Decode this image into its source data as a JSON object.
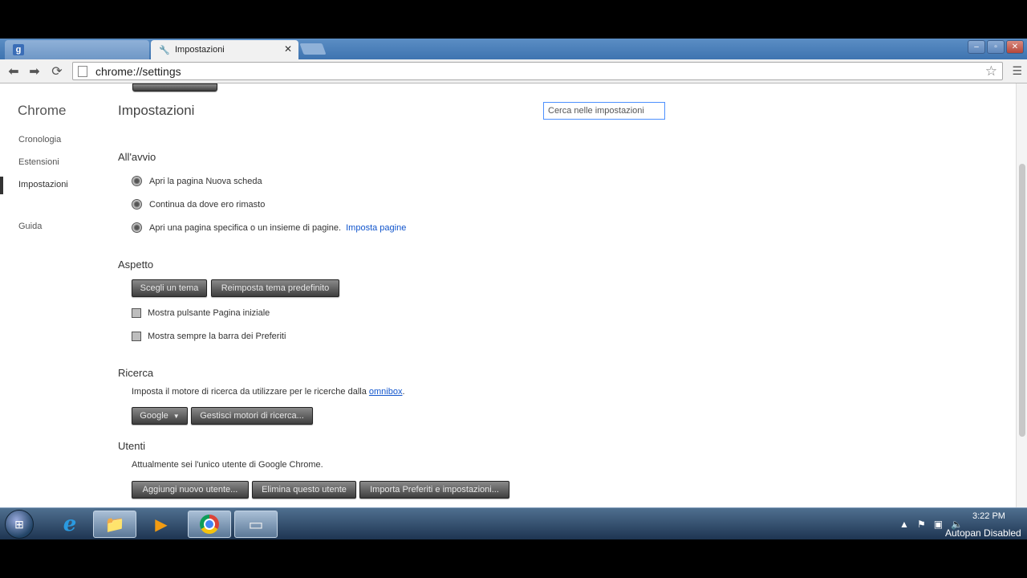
{
  "tabs": {
    "inactive_label": "",
    "active_label": "Impostazioni"
  },
  "window_controls": {
    "minimize": "–",
    "maximize": "▫",
    "close": "✕"
  },
  "omnibox": {
    "url": "chrome://settings"
  },
  "sidebar": {
    "title": "Chrome",
    "items": [
      {
        "label": "Cronologia"
      },
      {
        "label": "Estensioni"
      },
      {
        "label": "Impostazioni"
      },
      {
        "label": "Guida"
      }
    ]
  },
  "main": {
    "title": "Impostazioni",
    "search_placeholder": "Cerca nelle impostazioni",
    "startup": {
      "title": "All'avvio",
      "options": [
        "Apri la pagina Nuova scheda",
        "Continua da dove ero rimasto",
        "Apri una pagina specifica o un insieme di pagine."
      ],
      "set_pages_link": "Imposta pagine"
    },
    "appearance": {
      "title": "Aspetto",
      "choose_theme": "Scegli un tema",
      "reset_theme": "Reimposta tema predefinito",
      "show_home": "Mostra pulsante Pagina iniziale",
      "show_bookmarks": "Mostra sempre la barra dei Preferiti"
    },
    "search": {
      "title": "Ricerca",
      "description": "Imposta il motore di ricerca da utilizzare per le ricerche dalla",
      "omnibox_link": "omnibox",
      "description_end": ".",
      "engine": "Google",
      "manage_engines": "Gestisci motori di ricerca..."
    },
    "users": {
      "title": "Utenti",
      "description": "Attualmente sei l'unico utente di Google Chrome.",
      "add_user": "Aggiungi nuovo utente...",
      "delete_user": "Elimina questo utente",
      "import": "Importa Preferiti e impostazioni..."
    }
  },
  "taskbar": {
    "time": "3:22 PM",
    "autopan": "Autopan Disabled"
  }
}
